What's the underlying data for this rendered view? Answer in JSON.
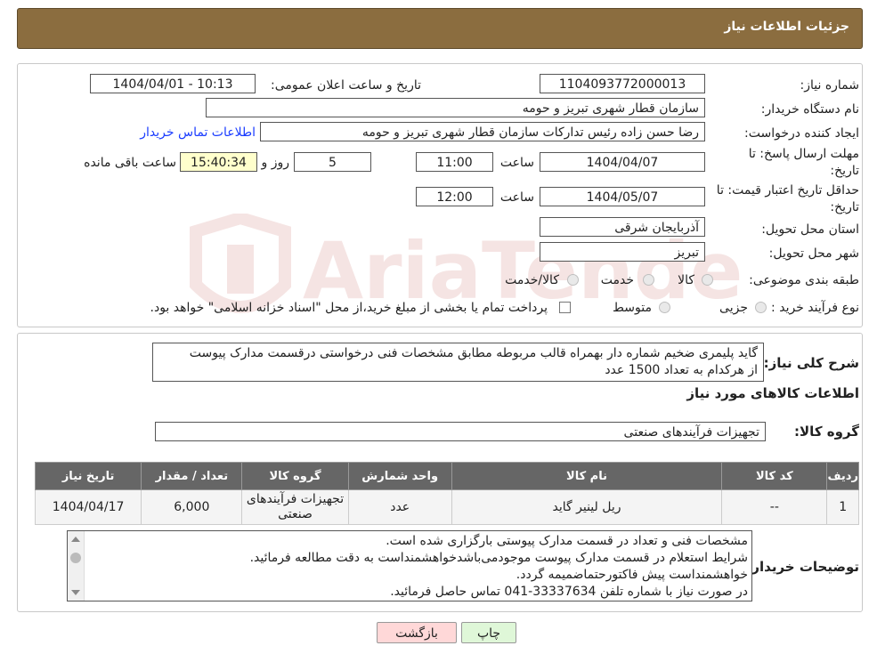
{
  "header": {
    "title": "جزئیات اطلاعات نیاز"
  },
  "form": {
    "need_number_label": "شماره نیاز:",
    "need_number": "1104093772000013",
    "announce_label": "تاریخ و ساعت اعلان عمومی:",
    "announce_value": "1404/04/01 - 10:13",
    "buyer_label": "نام دستگاه خریدار:",
    "buyer_value": "سازمان قطار شهری تبریز و حومه",
    "creator_label": "ایجاد کننده درخواست:",
    "creator_value": "رضا حسن زاده رئیس تدارکات سازمان قطار شهری تبریز و حومه",
    "contact_link": "اطلاعات تماس خریدار",
    "deadline_label_1": "مهلت ارسال پاسخ: تا",
    "deadline_label_2": "تاریخ:",
    "deadline_date": "1404/04/07",
    "time_label": "ساعت",
    "deadline_time": "11:00",
    "days_value": "5",
    "days_label": "روز و",
    "remaining_time": "15:40:34",
    "remaining_label": "ساعت باقی مانده",
    "validity_label_1": "حداقل تاریخ اعتبار قیمت: تا",
    "validity_label_2": "تاریخ:",
    "validity_date": "1404/05/07",
    "validity_time_label": "ساعت",
    "validity_time": "12:00",
    "province_label": "استان محل تحویل:",
    "province_value": "آذربایجان شرقی",
    "city_label": "شهر محل تحویل:",
    "city_value": "تبریز",
    "category_label": "طبقه بندی موضوعی:",
    "category_options": [
      "کالا",
      "خدمت",
      "کالا/خدمت"
    ],
    "purchase_type_label": "نوع فرآیند خرید :",
    "purchase_options": [
      "جزیی",
      "متوسط"
    ],
    "payment_note": "پرداخت تمام یا بخشی از مبلغ خرید،از محل \"اسناد خزانه اسلامی\" خواهد بود."
  },
  "details": {
    "summary_label": "شرح کلی نیاز:",
    "summary_line_1": "گاید پلیمری ضخیم شماره دار بهمراه قالب مربوطه مطابق مشخصات فنی درخواستی درقسمت مدارک پیوست",
    "summary_line_2": "از هرکدام به تعداد 1500 عدد",
    "items_title": "اطلاعات کالاهای مورد نیاز",
    "group_label": "گروه کالا:",
    "group_value": "تجهیزات فرآیندهای صنعتی"
  },
  "table": {
    "headers": [
      "ردیف",
      "کد کالا",
      "نام کالا",
      "واحد شمارش",
      "گروه کالا",
      "تعداد / مقدار",
      "تاریخ نیاز"
    ],
    "rows": [
      {
        "row": "1",
        "code": "--",
        "name": "ریل لینیر گاید",
        "unit": "عدد",
        "group_1": "تجهیزات فرآیندهای",
        "group_2": "صنعتی",
        "qty": "6,000",
        "date": "1404/04/17"
      }
    ]
  },
  "notes": {
    "label": "توضیحات خریدار:",
    "lines": [
      "مشخصات فنی و تعداد در قسمت مدارک پیوستی بارگزاری شده است.",
      "شرایط استعلام در قسمت مدارک پیوست موجودمی‌باشدخواهشمنداست به دقت مطالعه فرمائید.",
      "خواهشمنداست پیش فاکتورحتماضمیمه گردد.",
      "در صورت نیاز با شماره تلفن 33337634-041 تماس حاصل فرمائید."
    ]
  },
  "buttons": {
    "print": "چاپ",
    "back": "بازگشت"
  },
  "watermark": {
    "text": "AriaTender.neT"
  },
  "colors": {
    "header": "#8b6d3f",
    "back_button": "#ffd8d8",
    "print_button": "#dff7d8",
    "link": "#1a3cff"
  }
}
